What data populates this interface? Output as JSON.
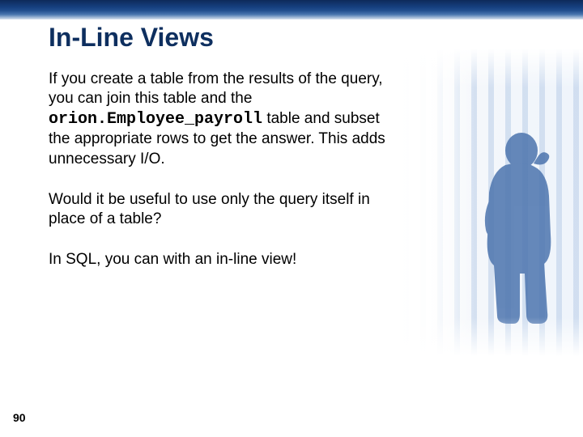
{
  "page": {
    "number": "90",
    "title": "In-Line Views"
  },
  "content": {
    "p1a": "If you create a table from the results of the query, you can join this table and the ",
    "code": "orion.Employee_payroll",
    "p1b": " table and subset the appropriate rows to get the answer. This adds unnecessary I/O.",
    "p2": "Would it be useful to use only the query itself in place of a table?",
    "p3": "In SQL, you can with an in-line view!"
  }
}
